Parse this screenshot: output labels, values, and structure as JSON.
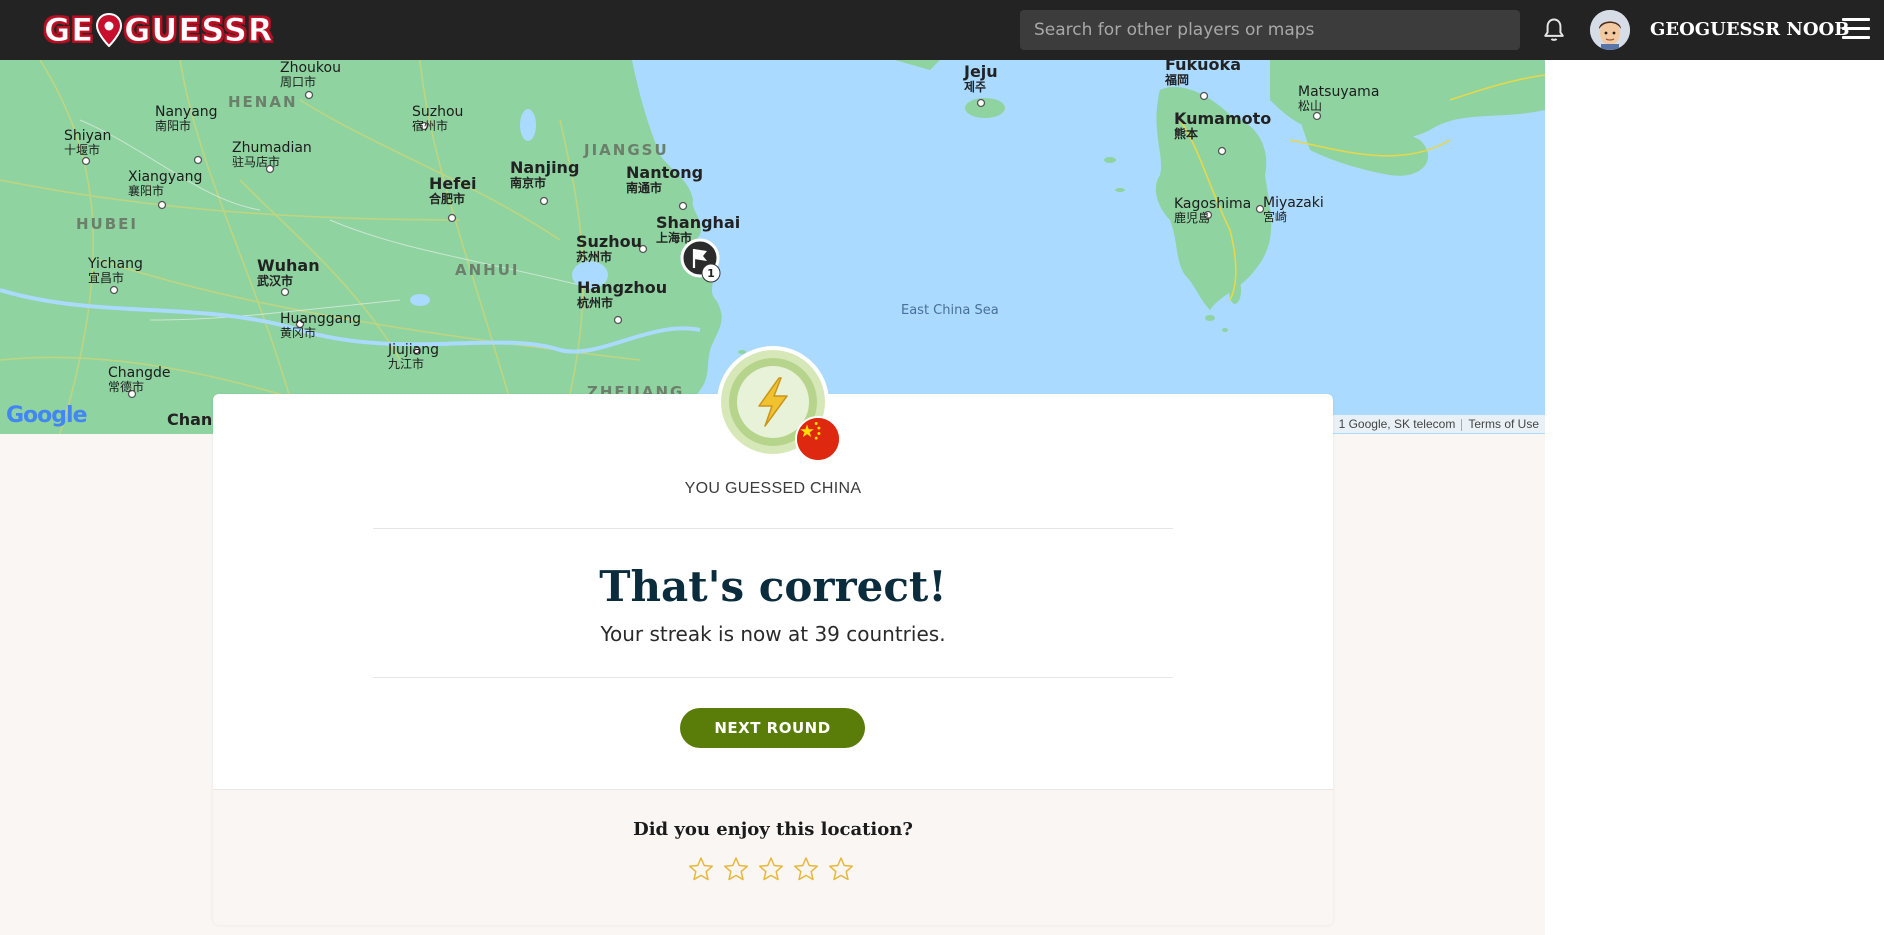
{
  "header": {
    "logo_parts": [
      "GE",
      "GUESSR"
    ],
    "search_placeholder": "Search for other players or maps",
    "username": "GEOGUESSR NOOB",
    "icons": [
      "bell-icon",
      "avatar",
      "hamburger-menu-icon"
    ]
  },
  "map": {
    "labels": {
      "zhoukou": "Zhoukou",
      "zhoukou_cn": "周口市",
      "henan": "HENAN",
      "nanyang": "Nanyang",
      "nanyang_cn": "南阳市",
      "suzhou_n": "Suzhou",
      "suzhou_n_cn": "宿州市",
      "shiyan": "Shiyan",
      "shiyan_cn": "十堰市",
      "zhumadian": "Zhumadian",
      "zhumadian_cn": "驻马店市",
      "jiangsu": "JIANGSU",
      "nanjing": "Nanjing",
      "nanjing_cn": "南京市",
      "nantong": "Nantong",
      "nantong_cn": "南通市",
      "hefei": "Hefei",
      "hefei_cn": "合肥市",
      "xiangyang": "Xiangyang",
      "xiangyang_cn": "襄阳市",
      "hubei": "HUBEI",
      "shanghai": "Shanghai",
      "shanghai_cn": "上海市",
      "suzhou": "Suzhou",
      "suzhou_cn": "苏州市",
      "anhui": "ANHUI",
      "yichang": "Yichang",
      "yichang_cn": "宜昌市",
      "wuhan": "Wuhan",
      "wuhan_cn": "武汉市",
      "hangzhou": "Hangzhou",
      "hangzhou_cn": "杭州市",
      "huanggang": "Huanggang",
      "huanggang_cn": "黄冈市",
      "jiujiang": "Jiujiang",
      "jiujiang_cn": "九江市",
      "changde": "Changde",
      "changde_cn": "常德市",
      "chang": "Chang",
      "zhejiang": "ZHEJIANG",
      "jeju": "Jeju",
      "jeju_kr": "제주",
      "fukuoka": "Fukuoka",
      "fukuoka_jp": "福岡",
      "matsuyama": "Matsuyama",
      "matsuyama_jp": "松山",
      "kumamoto": "Kumamoto",
      "kumamoto_jp": "熊本",
      "kagoshima": "Kagoshima",
      "kagoshima_jp": "鹿児島",
      "miyazaki": "Miyazaki",
      "miyazaki_jp": "宮崎",
      "east_china_sea": "East China Sea"
    },
    "marker_number": "1",
    "google_logo": "Google",
    "attribution": "1 Google, SK telecom",
    "terms": "Terms of Use"
  },
  "result": {
    "guess_label": "YOU GUESSED CHINA",
    "title": "That's correct!",
    "streak_text": "Your streak is now at 39 countries.",
    "next_button": "NEXT ROUND",
    "rating_question": "Did you enjoy this location?",
    "rating_stars": 0,
    "rating_max": 5
  },
  "colors": {
    "header_bg": "#232323",
    "land": "#8fd3a0",
    "sea": "#aadaff",
    "button": "#5a7d0a",
    "title": "#0b2c3d",
    "star": "#e8b73a"
  }
}
